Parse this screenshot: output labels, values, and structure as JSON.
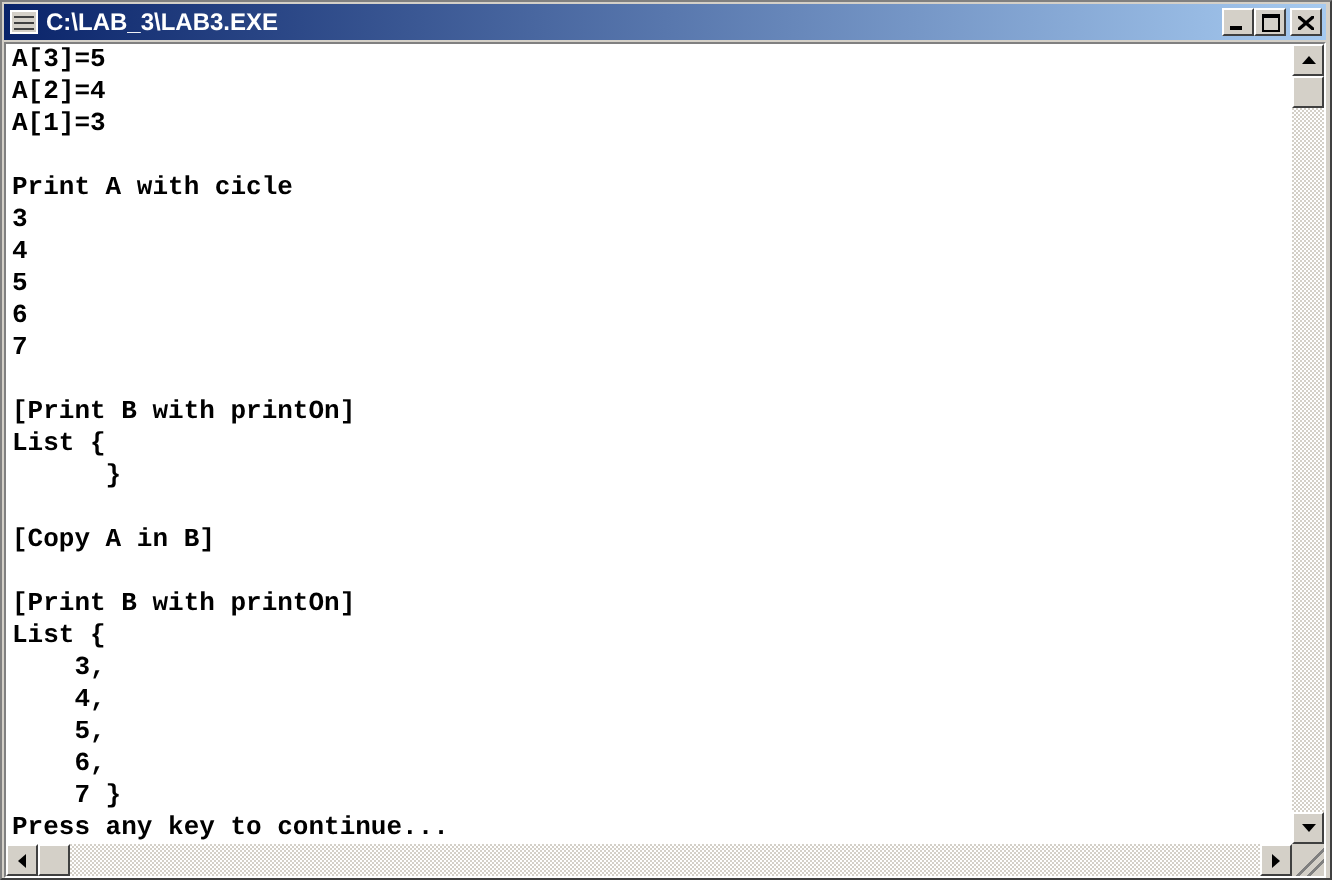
{
  "window": {
    "title": "C:\\LAB_3\\LAB3.EXE"
  },
  "console": {
    "lines": [
      {
        "kind": "text",
        "text": "A[3]=5"
      },
      {
        "kind": "text",
        "text": "A[2]=4"
      },
      {
        "kind": "text",
        "text": "A[1]=3"
      },
      {
        "kind": "blank"
      },
      {
        "kind": "text",
        "text": "Print A with cicle"
      },
      {
        "kind": "text",
        "text": "3"
      },
      {
        "kind": "text",
        "text": "4"
      },
      {
        "kind": "text",
        "text": "5"
      },
      {
        "kind": "text",
        "text": "6"
      },
      {
        "kind": "text",
        "text": "7"
      },
      {
        "kind": "blank"
      },
      {
        "kind": "text",
        "text": "[Print B with printOn]"
      },
      {
        "kind": "text",
        "text": "List {"
      },
      {
        "kind": "text",
        "text": "      }"
      },
      {
        "kind": "blank"
      },
      {
        "kind": "text",
        "text": "[Copy A in B]"
      },
      {
        "kind": "blank"
      },
      {
        "kind": "text",
        "text": "[Print B with printOn]"
      },
      {
        "kind": "text",
        "text": "List {"
      },
      {
        "kind": "text",
        "text": "    3,"
      },
      {
        "kind": "text",
        "text": "    4,"
      },
      {
        "kind": "text",
        "text": "    5,"
      },
      {
        "kind": "text",
        "text": "    6,"
      },
      {
        "kind": "text",
        "text": "    7 }"
      },
      {
        "kind": "text",
        "text": "Press any key to continue..."
      }
    ]
  }
}
